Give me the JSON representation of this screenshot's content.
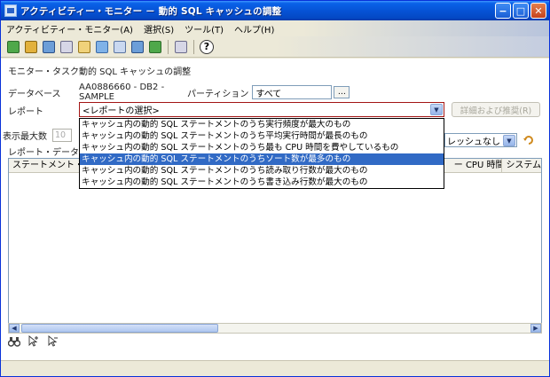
{
  "window": {
    "title": "アクティビティー・モニター － 動的 SQL キャッシュの調整",
    "controls": {
      "minimize": "−",
      "maximize": "□",
      "close": "✕"
    }
  },
  "menu": {
    "items": [
      "アクティビティー・モニター(A)",
      "選択(S)",
      "ツール(T)",
      "ヘルプ(H)"
    ]
  },
  "toolbar": {
    "icons": [
      "task-icon",
      "database-icon",
      "monitor-icon",
      "window-icon",
      "connect-icon",
      "db2-icon",
      "report-icon",
      "settings-icon",
      "export-icon",
      "window-small-icon",
      "help-icon"
    ],
    "help_glyph": "?"
  },
  "monitor": {
    "task_label": "モニター・タスク",
    "task_value": "動的 SQL キャッシュの調整",
    "database_label": "データベース",
    "database_value": "AA0886660 - DB2 - SAMPLE",
    "partition_label": "パーティション",
    "partition_value": "すべて",
    "partition_button": "…"
  },
  "report": {
    "label": "レポート",
    "selected": "<レポートの選択>",
    "detail_button": "詳細および推奨(R)",
    "options": [
      "キャッシュ内の動的 SQL ステートメントのうち実行頻度が最大のもの",
      "キャッシュ内の動的 SQL ステートメントのうち平均実行時間が最長のもの",
      "キャッシュ内の動的 SQL ステートメントのうち最も CPU 時間を費やしているもの",
      "キャッシュ内の動的 SQL ステートメントのうちソート数が最多のもの",
      "キャッシュ内の動的 SQL ステートメントのうち読み取り行数が最大のもの",
      "キャッシュ内の動的 SQL ステートメントのうち書き込み行数が最大のもの"
    ],
    "highlighted_index": 3
  },
  "display": {
    "max_label": "表示最大数",
    "max_value": "10",
    "data_label": "レポート・データ",
    "refresh_value": "レッシュなし"
  },
  "grid": {
    "columns": [
      "ステートメント・",
      "ー CPU 時間 ⇕",
      "システム"
    ]
  },
  "scroll": {
    "left": "◀",
    "right": "▶"
  },
  "bottom_tools": [
    "binoculars-icon",
    "cursor-plus-icon",
    "cursor-minus-icon"
  ]
}
